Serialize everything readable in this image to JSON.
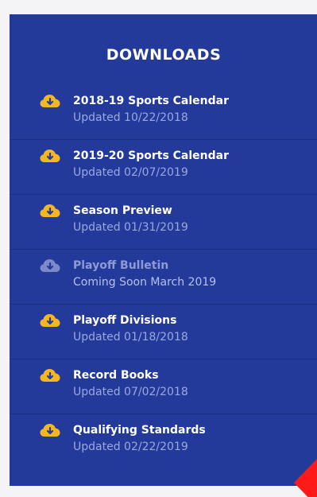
{
  "downloads": {
    "title": "DOWNLOADS",
    "items": [
      {
        "label": "2018-19 Sports Calendar",
        "status": "Updated 10/22/2018",
        "icon": "cloud-download-icon",
        "enabled": true
      },
      {
        "label": "2019-20 Sports Calendar",
        "status": "Updated 02/07/2019",
        "icon": "cloud-download-icon",
        "enabled": true
      },
      {
        "label": "Season Preview",
        "status": "Updated 01/31/2019",
        "icon": "cloud-download-icon",
        "enabled": true
      },
      {
        "label": "Playoff Bulletin",
        "status": "Coming Soon March 2019",
        "icon": "cloud-download-icon",
        "enabled": false
      },
      {
        "label": "Playoff Divisions",
        "status": "Updated 01/18/2018",
        "icon": "cloud-download-icon",
        "enabled": true
      },
      {
        "label": "Record Books",
        "status": "Updated 07/02/2018",
        "icon": "cloud-download-icon",
        "enabled": true
      },
      {
        "label": "Qualifying Standards",
        "status": "Updated 02/22/2019",
        "icon": "cloud-download-icon",
        "enabled": true
      }
    ]
  },
  "colors": {
    "panel": "#243a9a",
    "icon_active": "#f5b71f",
    "icon_disabled": "#7d89c9",
    "accent_triangle": "#ff1a1a"
  }
}
